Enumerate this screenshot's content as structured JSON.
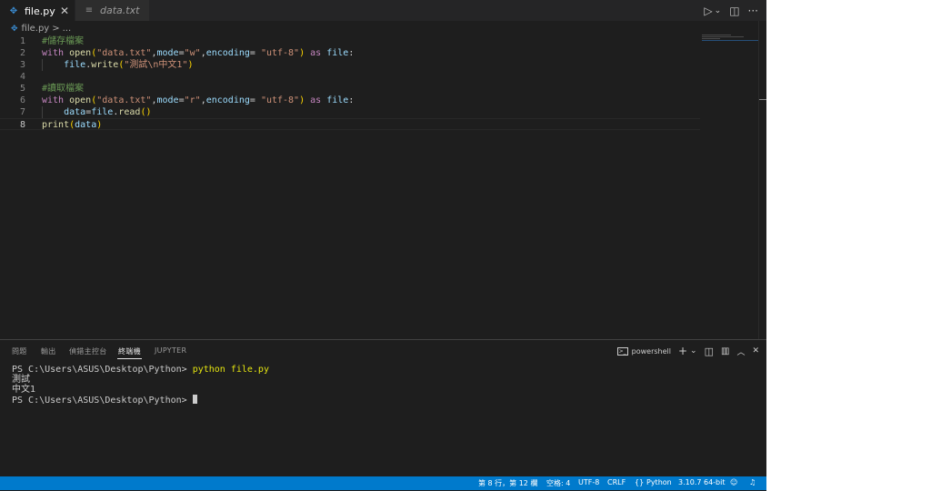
{
  "tabs": [
    {
      "label": "file.py",
      "icon": "python-file-icon",
      "close": "✕"
    },
    {
      "label": "data.txt",
      "icon": "text-file-icon"
    }
  ],
  "toolbar": {
    "run": "▷",
    "run_menu": "⌄",
    "split": "◫",
    "more": "···"
  },
  "breadcrumb": {
    "file": "file.py",
    "separator": ">",
    "more": "..."
  },
  "editor": {
    "current_line": 8,
    "lines": [
      {
        "n": "1",
        "tokens": [
          {
            "t": "#儲存檔案",
            "c": "cm"
          }
        ]
      },
      {
        "n": "2",
        "tokens": [
          {
            "t": "with",
            "c": "kw"
          },
          {
            "t": " ",
            "c": "p"
          },
          {
            "t": "open",
            "c": "fn"
          },
          {
            "t": "(",
            "c": "br"
          },
          {
            "t": "\"data.txt\"",
            "c": "str"
          },
          {
            "t": ",",
            "c": "p"
          },
          {
            "t": "mode",
            "c": "var"
          },
          {
            "t": "=",
            "c": "p"
          },
          {
            "t": "\"w\"",
            "c": "str"
          },
          {
            "t": ",",
            "c": "p"
          },
          {
            "t": "encoding",
            "c": "var"
          },
          {
            "t": "= ",
            "c": "p"
          },
          {
            "t": "\"utf-8\"",
            "c": "str"
          },
          {
            "t": ")",
            "c": "br"
          },
          {
            "t": " ",
            "c": "p"
          },
          {
            "t": "as",
            "c": "kw"
          },
          {
            "t": " ",
            "c": "p"
          },
          {
            "t": "file",
            "c": "var"
          },
          {
            "t": ":",
            "c": "p"
          }
        ]
      },
      {
        "n": "3",
        "indent": true,
        "tokens": [
          {
            "t": "    ",
            "c": "p"
          },
          {
            "t": "file",
            "c": "var"
          },
          {
            "t": ".",
            "c": "p"
          },
          {
            "t": "write",
            "c": "fn"
          },
          {
            "t": "(",
            "c": "br"
          },
          {
            "t": "\"測試\\n中文1\"",
            "c": "str"
          },
          {
            "t": ")",
            "c": "br"
          }
        ]
      },
      {
        "n": "4",
        "tokens": []
      },
      {
        "n": "5",
        "tokens": [
          {
            "t": "#讀取檔案",
            "c": "cm"
          }
        ]
      },
      {
        "n": "6",
        "tokens": [
          {
            "t": "with",
            "c": "kw"
          },
          {
            "t": " ",
            "c": "p"
          },
          {
            "t": "open",
            "c": "fn"
          },
          {
            "t": "(",
            "c": "br"
          },
          {
            "t": "\"data.txt\"",
            "c": "str"
          },
          {
            "t": ",",
            "c": "p"
          },
          {
            "t": "mode",
            "c": "var"
          },
          {
            "t": "=",
            "c": "p"
          },
          {
            "t": "\"r\"",
            "c": "str"
          },
          {
            "t": ",",
            "c": "p"
          },
          {
            "t": "encoding",
            "c": "var"
          },
          {
            "t": "= ",
            "c": "p"
          },
          {
            "t": "\"utf-8\"",
            "c": "str"
          },
          {
            "t": ")",
            "c": "br"
          },
          {
            "t": " ",
            "c": "p"
          },
          {
            "t": "as",
            "c": "kw"
          },
          {
            "t": " ",
            "c": "p"
          },
          {
            "t": "file",
            "c": "var"
          },
          {
            "t": ":",
            "c": "p"
          }
        ]
      },
      {
        "n": "7",
        "indent": true,
        "tokens": [
          {
            "t": "    ",
            "c": "p"
          },
          {
            "t": "data",
            "c": "var"
          },
          {
            "t": "=",
            "c": "p"
          },
          {
            "t": "file",
            "c": "var"
          },
          {
            "t": ".",
            "c": "p"
          },
          {
            "t": "read",
            "c": "fn"
          },
          {
            "t": "()",
            "c": "br"
          }
        ]
      },
      {
        "n": "8",
        "tokens": [
          {
            "t": "print",
            "c": "fn"
          },
          {
            "t": "(",
            "c": "br"
          },
          {
            "t": "data",
            "c": "var"
          },
          {
            "t": ")",
            "c": "br"
          }
        ]
      }
    ]
  },
  "panel": {
    "tabs": [
      "問題",
      "輸出",
      "偵錯主控台",
      "終端機",
      "JUPYTER"
    ],
    "active_tab": "終端機",
    "terminal_name": "powershell",
    "actions": {
      "add": "+",
      "add_menu": "⌄",
      "split": "◫",
      "trash": "🗑",
      "maximize": "︿",
      "close": "✕"
    },
    "terminal": {
      "prompt1": "PS C:\\Users\\ASUS\\Desktop\\Python> ",
      "command": "python file.py",
      "output1": "測試",
      "output2": "中文1",
      "prompt2": "PS C:\\Users\\ASUS\\Desktop\\Python> "
    }
  },
  "statusbar": {
    "position": "第 8 行，第 12 欄",
    "spaces": "空格: 4",
    "encoding": "UTF-8",
    "eol": "CRLF",
    "language": "Python",
    "interpreter": "3.10.7 64-bit"
  },
  "colors": {
    "statusbar": "#007acc",
    "editor_bg": "#1e1e1e",
    "tabbar_bg": "#252526"
  }
}
